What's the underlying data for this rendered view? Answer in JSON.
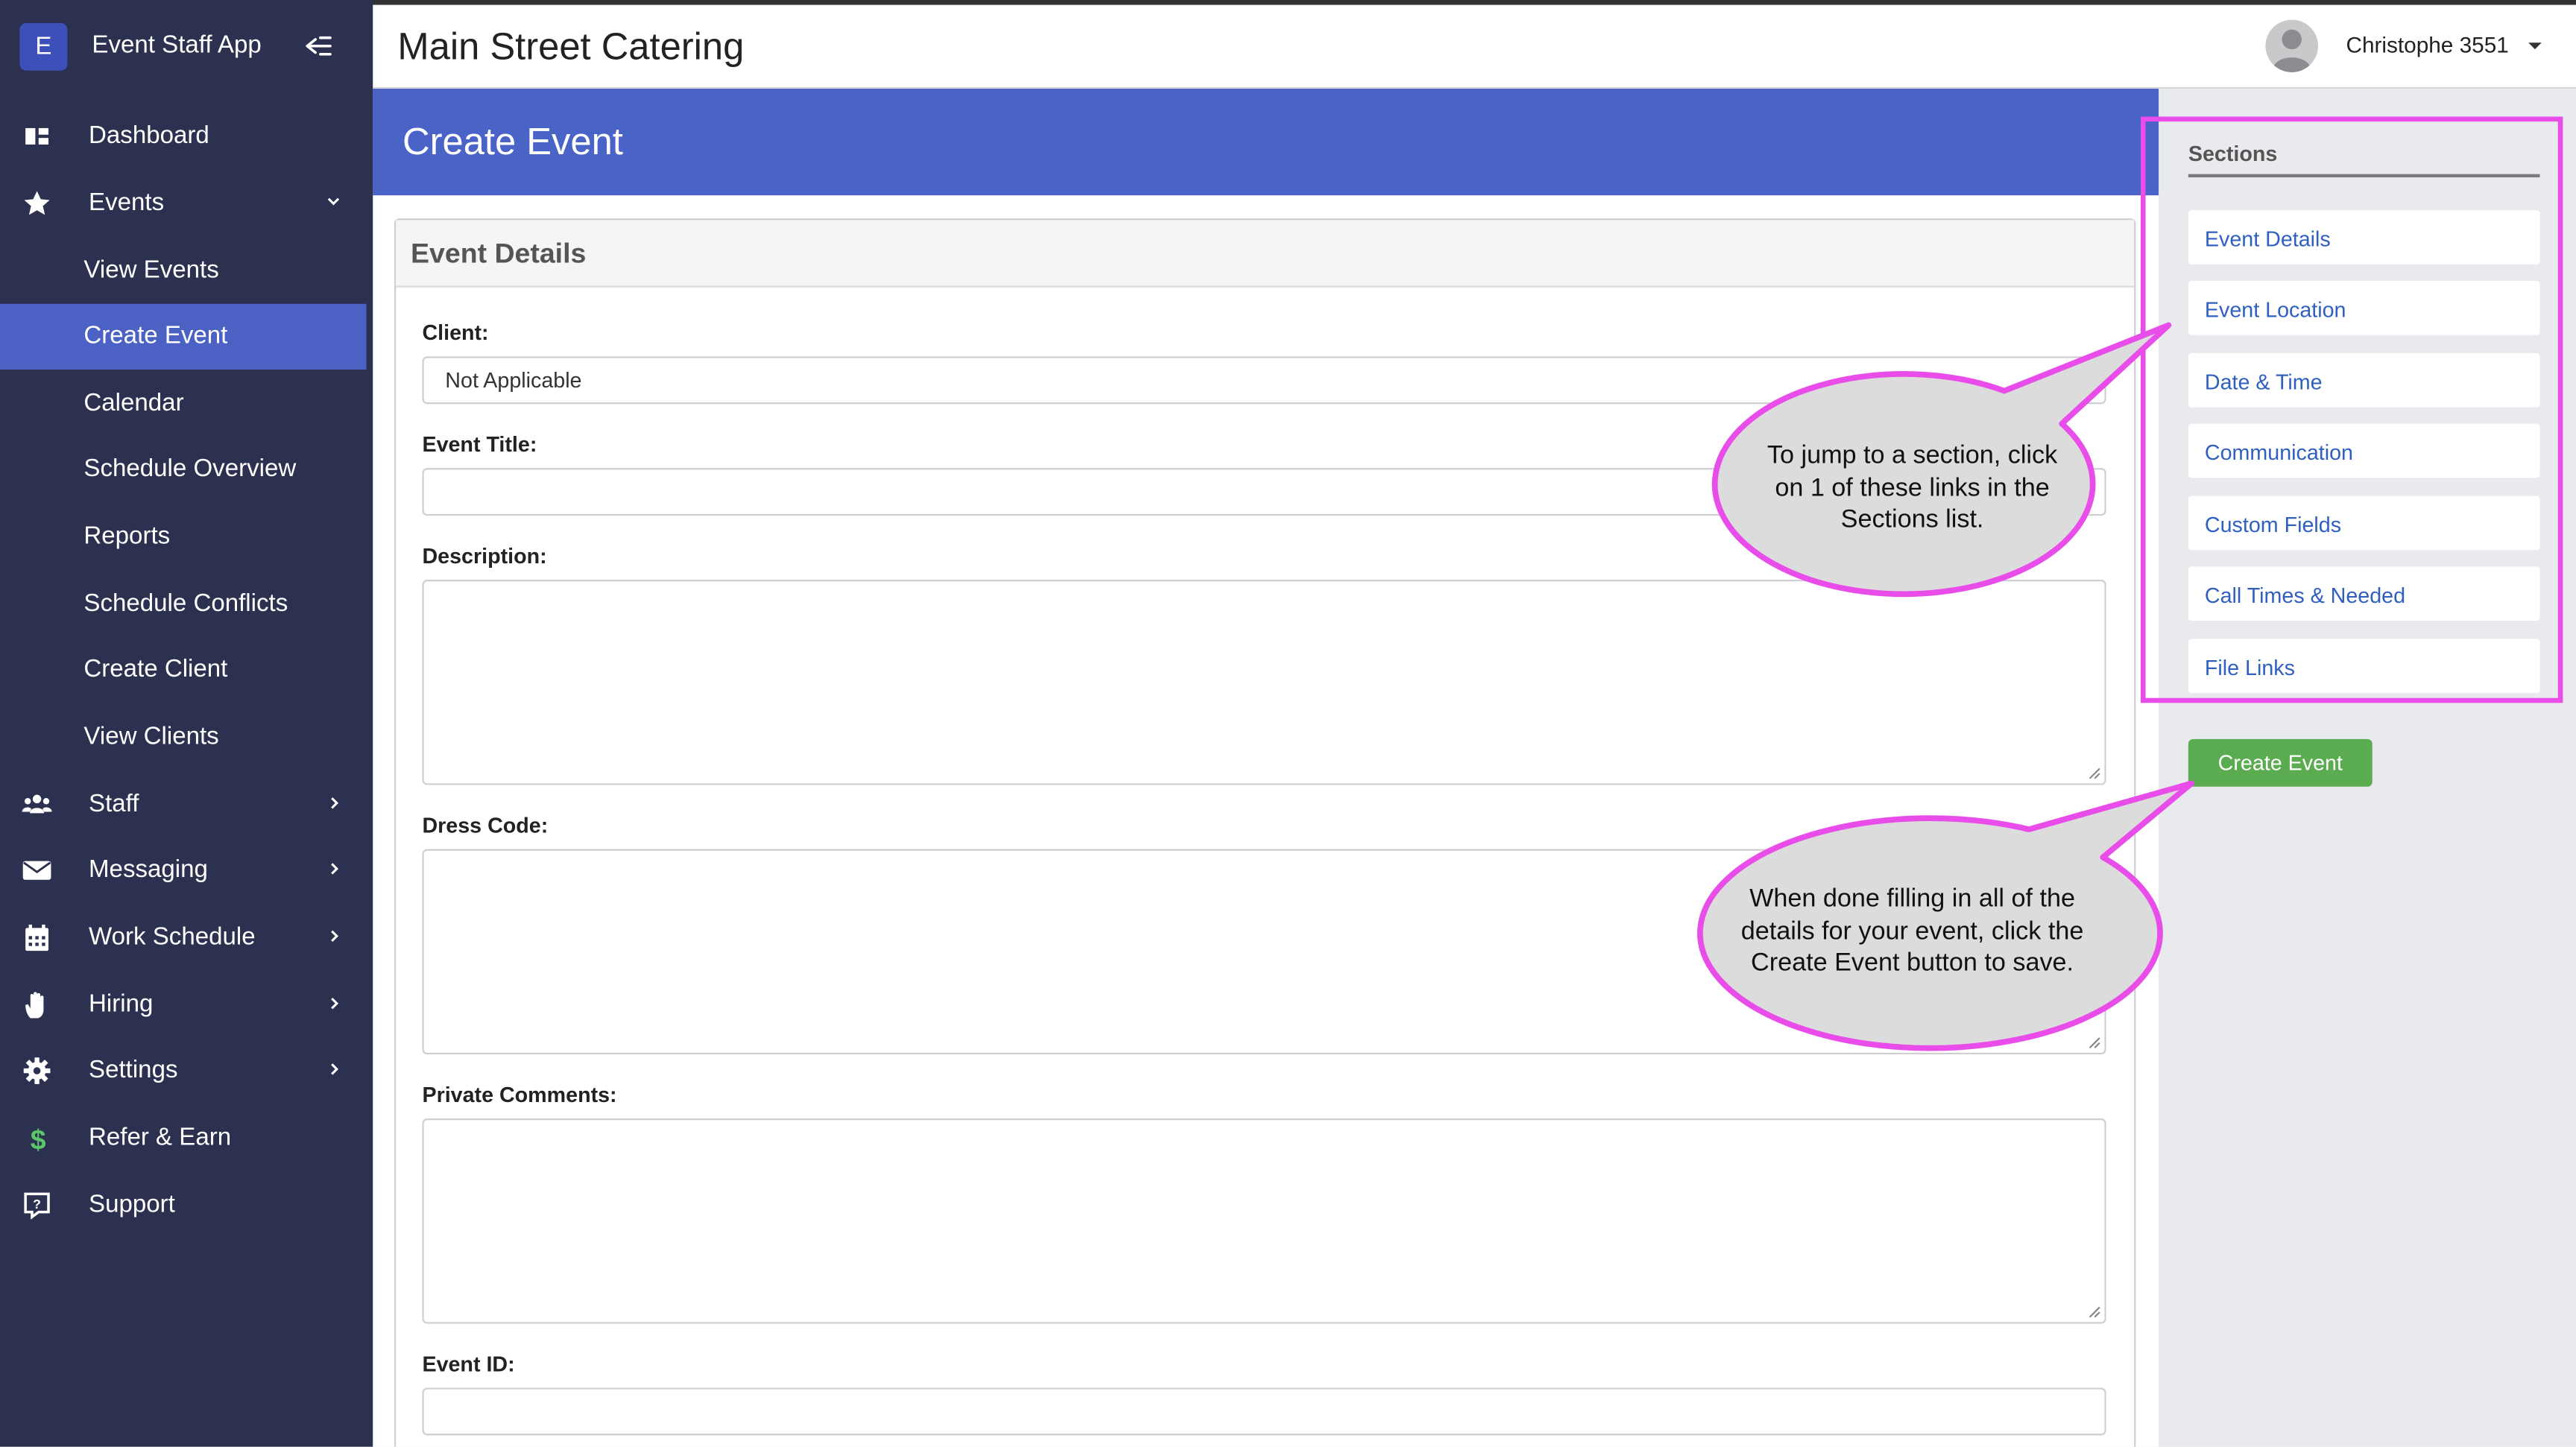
{
  "app": {
    "brand_initial": "E",
    "brand_name": "Event Staff App"
  },
  "sidebar": {
    "items": [
      {
        "label": "Dashboard",
        "icon": "dashboard-icon"
      },
      {
        "label": "Events",
        "icon": "star-icon"
      },
      {
        "label": "View Events"
      },
      {
        "label": "Create Event",
        "active": true
      },
      {
        "label": "Calendar"
      },
      {
        "label": "Schedule Overview"
      },
      {
        "label": "Reports"
      },
      {
        "label": "Schedule Conflicts"
      },
      {
        "label": "Create Client"
      },
      {
        "label": "View Clients"
      },
      {
        "label": "Staff",
        "icon": "users-icon"
      },
      {
        "label": "Messaging",
        "icon": "envelope-icon"
      },
      {
        "label": "Work Schedule",
        "icon": "calendar-icon"
      },
      {
        "label": "Hiring",
        "icon": "hand-icon"
      },
      {
        "label": "Settings",
        "icon": "gear-icon"
      },
      {
        "label": "Refer & Earn",
        "icon": "dollar-icon"
      },
      {
        "label": "Support",
        "icon": "support-icon"
      }
    ]
  },
  "header": {
    "company": "Main Street Catering",
    "user_name": "Christophe 3551"
  },
  "page": {
    "title": "Create Event"
  },
  "form": {
    "card_title": "Event Details",
    "client_label": "Client:",
    "client_value": "Not Applicable",
    "title_label": "Event Title:",
    "title_value": "",
    "description_label": "Description:",
    "dress_code_label": "Dress Code:",
    "private_comments_label": "Private Comments:",
    "event_id_label": "Event ID:",
    "event_id_value": ""
  },
  "sections": {
    "heading": "Sections",
    "links": [
      "Event Details",
      "Event Location",
      "Date & Time",
      "Communication",
      "Custom Fields",
      "Call Times & Needed",
      "File Links"
    ],
    "create_button": "Create Event"
  },
  "callouts": {
    "sections_lines": [
      "To jump to a section, click",
      "on 1 of these links in the",
      "Sections list."
    ],
    "create_lines": [
      "When done filling in all of the",
      "details for your event, click the",
      "Create Event button to save."
    ]
  },
  "colors": {
    "sidebar_bg": "#2c3150",
    "active_bg": "#4b62c4",
    "page_band": "#4a63c7",
    "link": "#2f5fbf",
    "button_green": "#5bab50",
    "callout_border": "#e94de9",
    "callout_fill": "#dcdcdc"
  }
}
